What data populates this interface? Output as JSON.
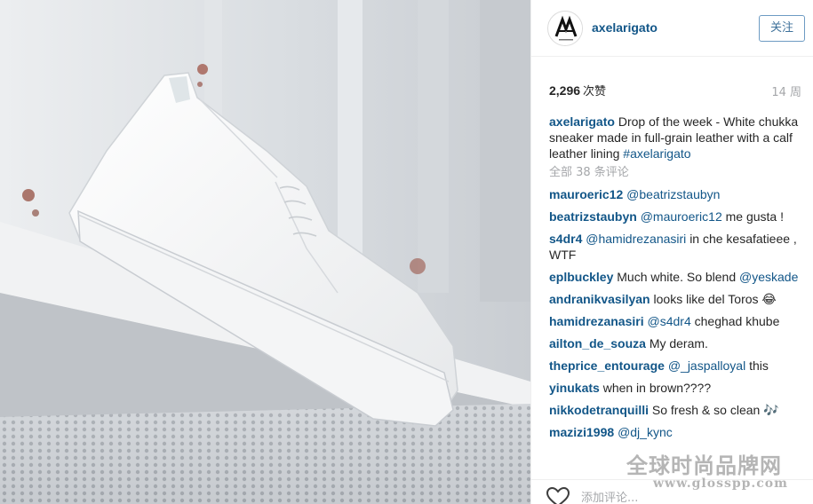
{
  "header": {
    "username": "axelarigato",
    "follow_label": "关注"
  },
  "stats": {
    "likes_count": "2,296",
    "likes_unit": "次赞",
    "time_ago": "14 周"
  },
  "caption": {
    "user": "axelarigato",
    "text": "Drop of the week - White chukka sneaker made in full-grain leather with a calf leather lining",
    "hashtag": "#axelarigato"
  },
  "all_comments_label": "全部 38 条评论",
  "comments": [
    {
      "user": "mauroeric12",
      "mention": "@beatrizstaubyn",
      "text": ""
    },
    {
      "user": "beatrizstaubyn",
      "mention": "@mauroeric12",
      "text": "me gusta !"
    },
    {
      "user": "s4dr4",
      "mention": "@hamidrezanasiri",
      "text": "in che kesafatieee , WTF"
    },
    {
      "user": "eplbuckley",
      "mention": "",
      "text": "Much white. So blend",
      "mention_after": "@yeskade"
    },
    {
      "user": "andranikvasilyan",
      "mention": "",
      "text": "looks like del Toros 😂"
    },
    {
      "user": "hamidrezanasiri",
      "mention": "@s4dr4",
      "text": "cheghad khube"
    },
    {
      "user": "ailton_de_souza",
      "mention": "",
      "text": "My deram."
    },
    {
      "user": "theprice_entourage",
      "mention": "@_jaspalloyal",
      "text": "this"
    },
    {
      "user": "yinukats",
      "mention": "",
      "text": "when in brown????"
    },
    {
      "user": "nikkodetranquilli",
      "mention": "",
      "text": "So fresh & so clean 🎶"
    },
    {
      "user": "mazizi1998",
      "mention": "@dj_kync",
      "text": ""
    }
  ],
  "footer": {
    "add_comment_placeholder": "添加评论..."
  },
  "watermark": {
    "cn": "全球时尚品牌网",
    "url": "www.glosspp.com"
  },
  "icons": {
    "avatar_logo": "axel-arigato-logo",
    "like": "heart-outline-icon"
  },
  "colors": {
    "link_blue": "#125688",
    "follow_border": "#6d9bc3",
    "muted_gray": "#a5a7aa"
  }
}
